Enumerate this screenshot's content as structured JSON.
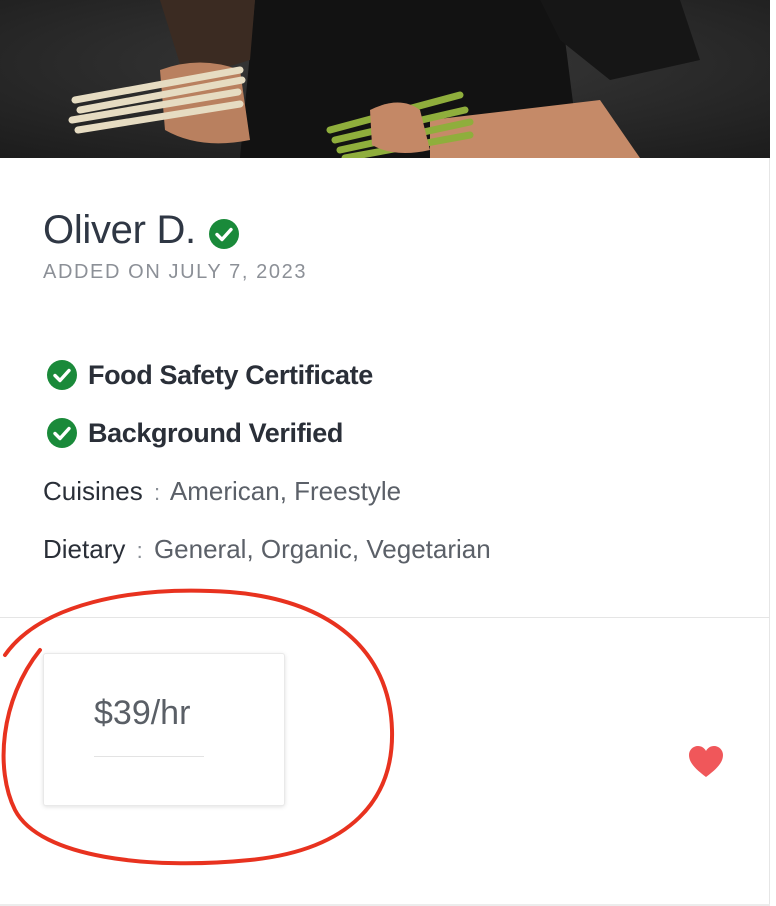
{
  "chef": {
    "name": "Oliver D.",
    "added": "ADDED ON JULY 7, 2023"
  },
  "credentials": [
    {
      "label": "Food Safety Certificate"
    },
    {
      "label": "Background Verified"
    }
  ],
  "details": {
    "cuisines": {
      "label": "Cuisines",
      "separator": ":",
      "value": "American, Freestyle"
    },
    "dietary": {
      "label": "Dietary",
      "separator": ":",
      "value": "General, Organic, Vegetarian"
    }
  },
  "pricing": {
    "rate": "$39/hr"
  },
  "colors": {
    "verified_green": "#1a8a3a",
    "heart_red": "#f0575a",
    "annotation_red": "#e8321f"
  }
}
